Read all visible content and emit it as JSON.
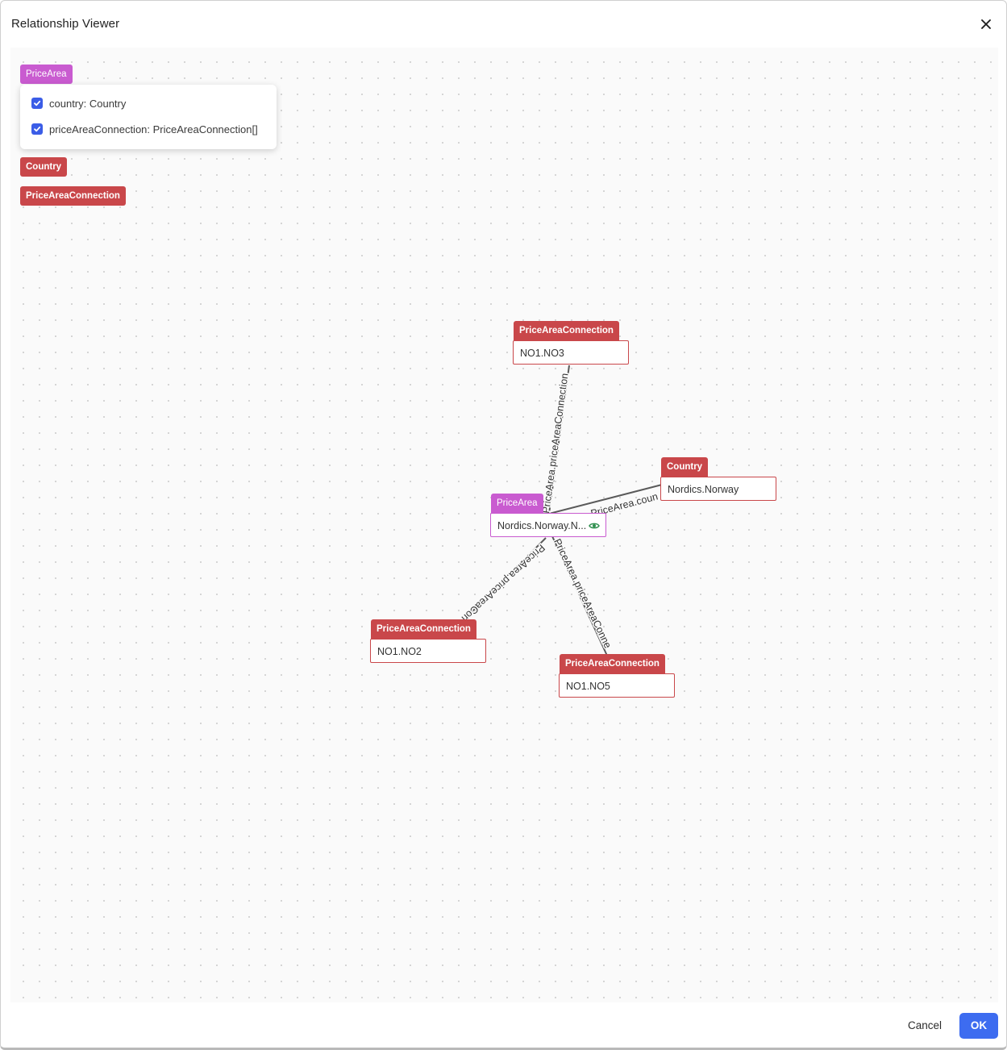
{
  "window": {
    "title": "Relationship Viewer",
    "close_icon": "close-icon"
  },
  "legend": {
    "selected_type": "PriceArea",
    "popup": {
      "items": [
        {
          "label": "country: Country",
          "checked": true
        },
        {
          "label": "priceAreaConnection: PriceAreaConnection[]",
          "checked": true
        }
      ]
    },
    "types": [
      "Country",
      "PriceAreaConnection"
    ]
  },
  "graph": {
    "center": {
      "type": "PriceArea",
      "name": "Nordics.Norway.N...",
      "icon": "eye-icon"
    },
    "nodes": [
      {
        "type": "PriceAreaConnection",
        "name": "NO1.NO3"
      },
      {
        "type": "Country",
        "name": "Nordics.Norway"
      },
      {
        "type": "PriceAreaConnection",
        "name": "NO1.NO2"
      },
      {
        "type": "PriceAreaConnection",
        "name": "NO1.NO5"
      }
    ],
    "edges": [
      "PriceArea.priceAreaConnection",
      "PriceArea.coun",
      "PriceArea.priceAreaCon",
      "PriceArea.priceAreaConne"
    ]
  },
  "colors": {
    "country_tag": "#c9474a",
    "connection_tag": "#c9474a",
    "price_area_tag": "#c95bd0",
    "checkbox": "#3b5de7",
    "ok_button": "#3d6cf0"
  },
  "footer": {
    "cancel_label": "Cancel",
    "ok_label": "OK"
  }
}
